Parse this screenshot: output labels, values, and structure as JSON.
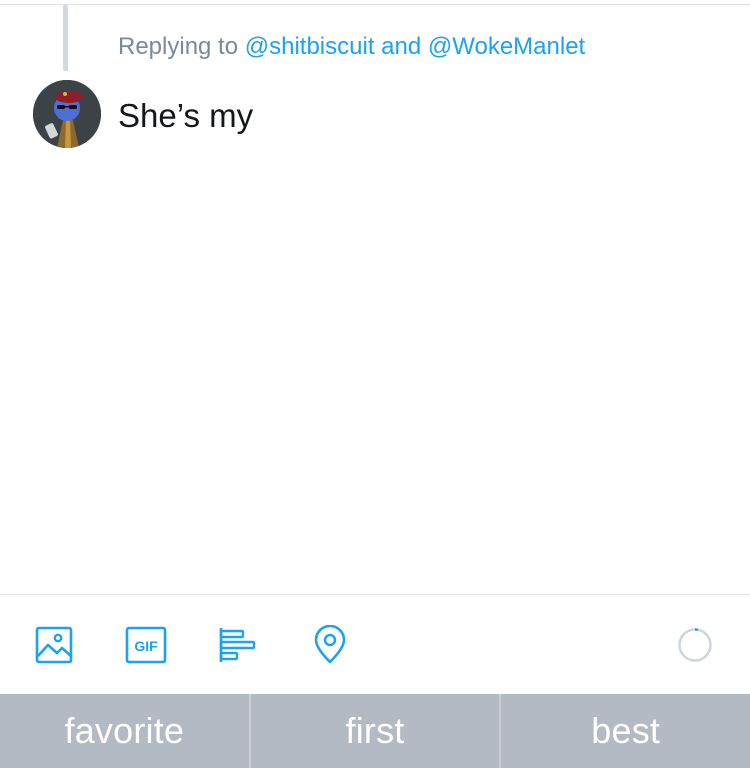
{
  "reply_context": {
    "prefix": "Replying to",
    "handle_1": "@shitbiscuit",
    "conjunction": "and",
    "handle_2": "@WokeManlet"
  },
  "composer": {
    "text": "She’s my"
  },
  "toolbar": {
    "tools": [
      "image-icon",
      "gif-icon",
      "poll-icon",
      "location-icon"
    ],
    "gif_label": "GIF",
    "counter_progress": 0.03
  },
  "suggestions": [
    "favorite",
    "first",
    "best"
  ],
  "colors": {
    "accent": "#1da1f2",
    "muted_text": "#7b8a98",
    "keyboard_bar": "#b4bac3"
  }
}
